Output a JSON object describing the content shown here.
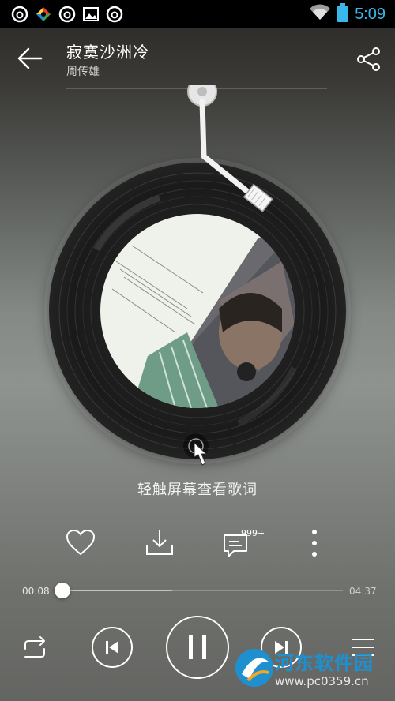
{
  "status_bar": {
    "time": "5:09",
    "icons": [
      "netease-music-icon",
      "colorful-app-icon",
      "netease-music-icon",
      "gallery-icon",
      "netease-music-icon"
    ],
    "battery_color": "#39b7ea"
  },
  "header": {
    "song_title": "寂寞沙洲冷",
    "artist": "周传雄"
  },
  "player": {
    "lyric_hint": "轻触屏幕查看歌词",
    "comment_count": "999+",
    "current_time": "00:08",
    "total_time": "04:37",
    "progress_fraction": 0.03,
    "accent_color": "#d33333"
  },
  "watermark": {
    "name": "河东软件园",
    "url": "www.pc0359.cn"
  }
}
